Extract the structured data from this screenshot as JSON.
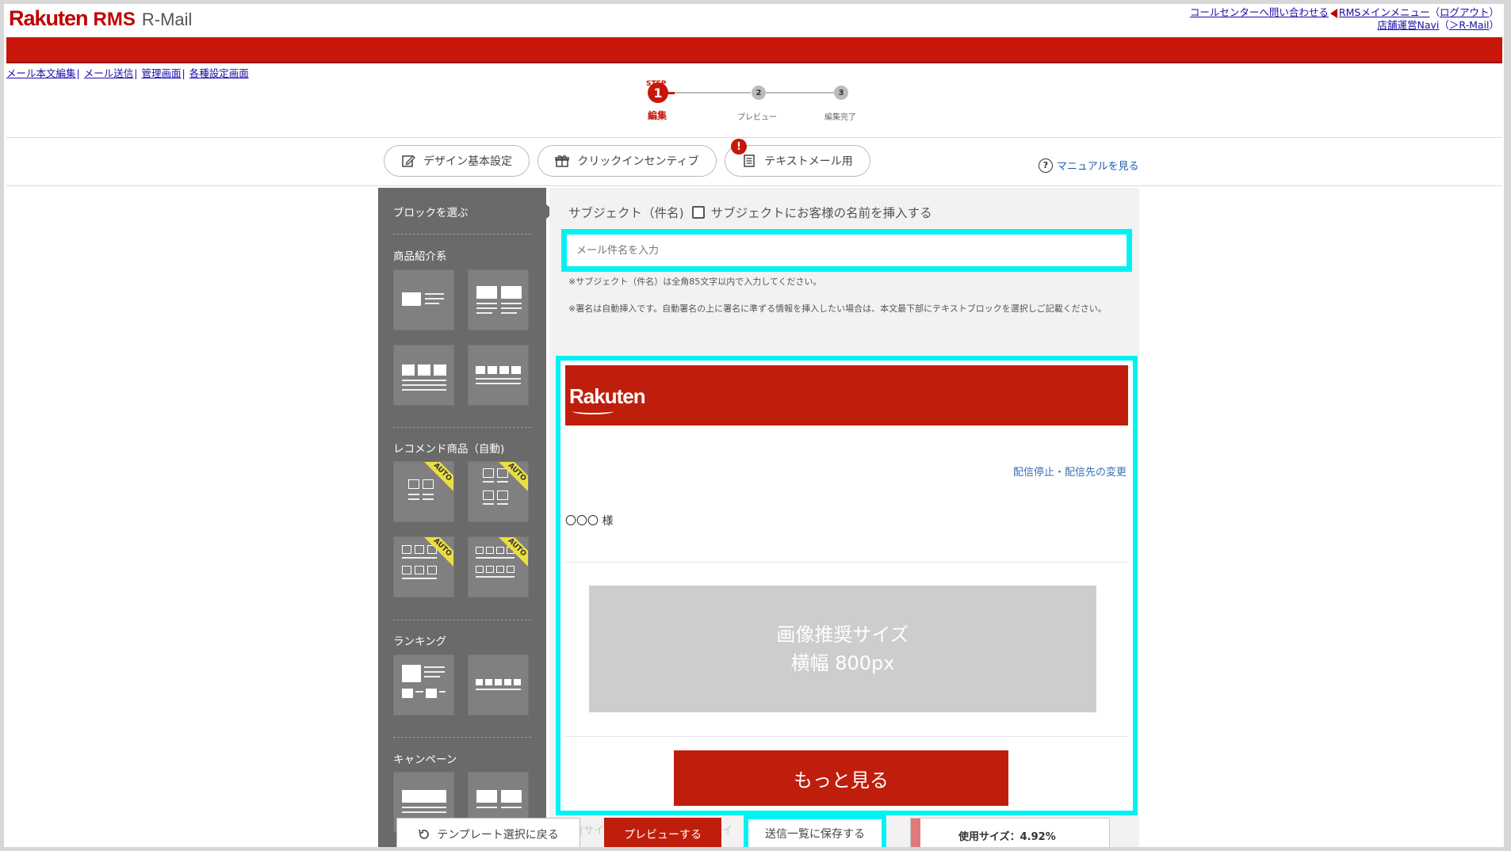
{
  "header": {
    "logo_rakuten": "Rakuten",
    "logo_rms": "RMS",
    "logo_rmail": "R-Mail",
    "link_callcenter": "コールセンターへ問い合わせる",
    "link_rms_menu": "RMSメインメニュー",
    "paren_open": "（",
    "link_logout": "ログアウト",
    "paren_close": "）",
    "link_navi": "店舗運営Navi",
    "paren2_open": "（",
    "link_rmail": "＞R-Mail",
    "paren2_close": "）"
  },
  "nav": [
    {
      "label": "メール本文編集"
    },
    {
      "label": "メール送信"
    },
    {
      "label": "管理画面"
    },
    {
      "label": "各種設定画面"
    }
  ],
  "nav_sep": "|",
  "steps": {
    "label": "STEP",
    "items": [
      {
        "num": "1",
        "name": "編集"
      },
      {
        "num": "2",
        "name": "プレビュー"
      },
      {
        "num": "3",
        "name": "編集完了"
      }
    ]
  },
  "tabs": {
    "design": "デザイン基本設定",
    "click": "クリックインセンティブ",
    "text_mail": "テキストメール用",
    "alert": "!",
    "manual": "マニュアルを見る",
    "manual_icon": "?"
  },
  "sidebar": {
    "title": "ブロックを選ぶ",
    "sections": [
      {
        "name": "商品紹介系"
      },
      {
        "name": "レコメンド商品（自動)"
      },
      {
        "name": "ランキング"
      },
      {
        "name": "キャンペーン"
      }
    ],
    "auto_badge": "AUTO"
  },
  "subject": {
    "label": "サブジェクト（件名)",
    "insert_name_label": "サブジェクトにお客様の名前を挿入する",
    "placeholder": "メール件名を入力",
    "note1": "※サブジェクト（件名）は全角85文字以内で入力してください。",
    "note2": "※署名は自動挿入です。自動署名の上に署名に準ずる情報を挿入したい場合は、本文最下部にテキストブロックを選択しご記載ください。"
  },
  "mail_preview": {
    "logo": "Rakuten",
    "unsubscribe": "配信停止・配信先の変更",
    "greeting": "〇〇〇 様",
    "image_line1": "画像推奨サイズ",
    "image_line2": "横幅 800px",
    "more_button": "もっと見る"
  },
  "bottom": {
    "back": "テンプレート選択に戻る",
    "preview": "プレビューする",
    "save": "送信一覧に保存する",
    "size_label": "使用サイズ：",
    "size_value": "4.92%",
    "size_fraction": 0.0492
  },
  "colors": {
    "brand_red": "#c8170a",
    "highlight_cyan": "#00f2f2",
    "sidebar_gray": "#6a6a6a"
  }
}
